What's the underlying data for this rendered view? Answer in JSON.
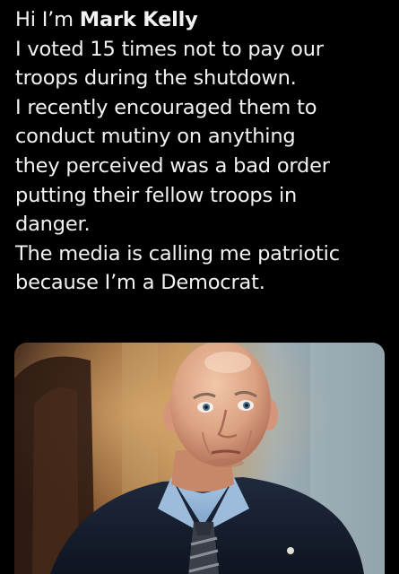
{
  "post": {
    "greeting": "Hi I’m ",
    "name": "Mark Kelly",
    "lines": [
      "I voted 15 times not to pay our",
      "troops during the shutdown.",
      "I recently encouraged them to",
      "conduct mutiny on anything",
      "they perceived was a bad order",
      "putting their fellow troops in",
      "danger.",
      "The media is calling me patriotic",
      "because I’m a Democrat."
    ]
  },
  "media": {
    "kind": "photo",
    "subject": "bald man in suit and blue shirt"
  },
  "colors": {
    "background": "#000000",
    "text": "#f2f2f2"
  }
}
